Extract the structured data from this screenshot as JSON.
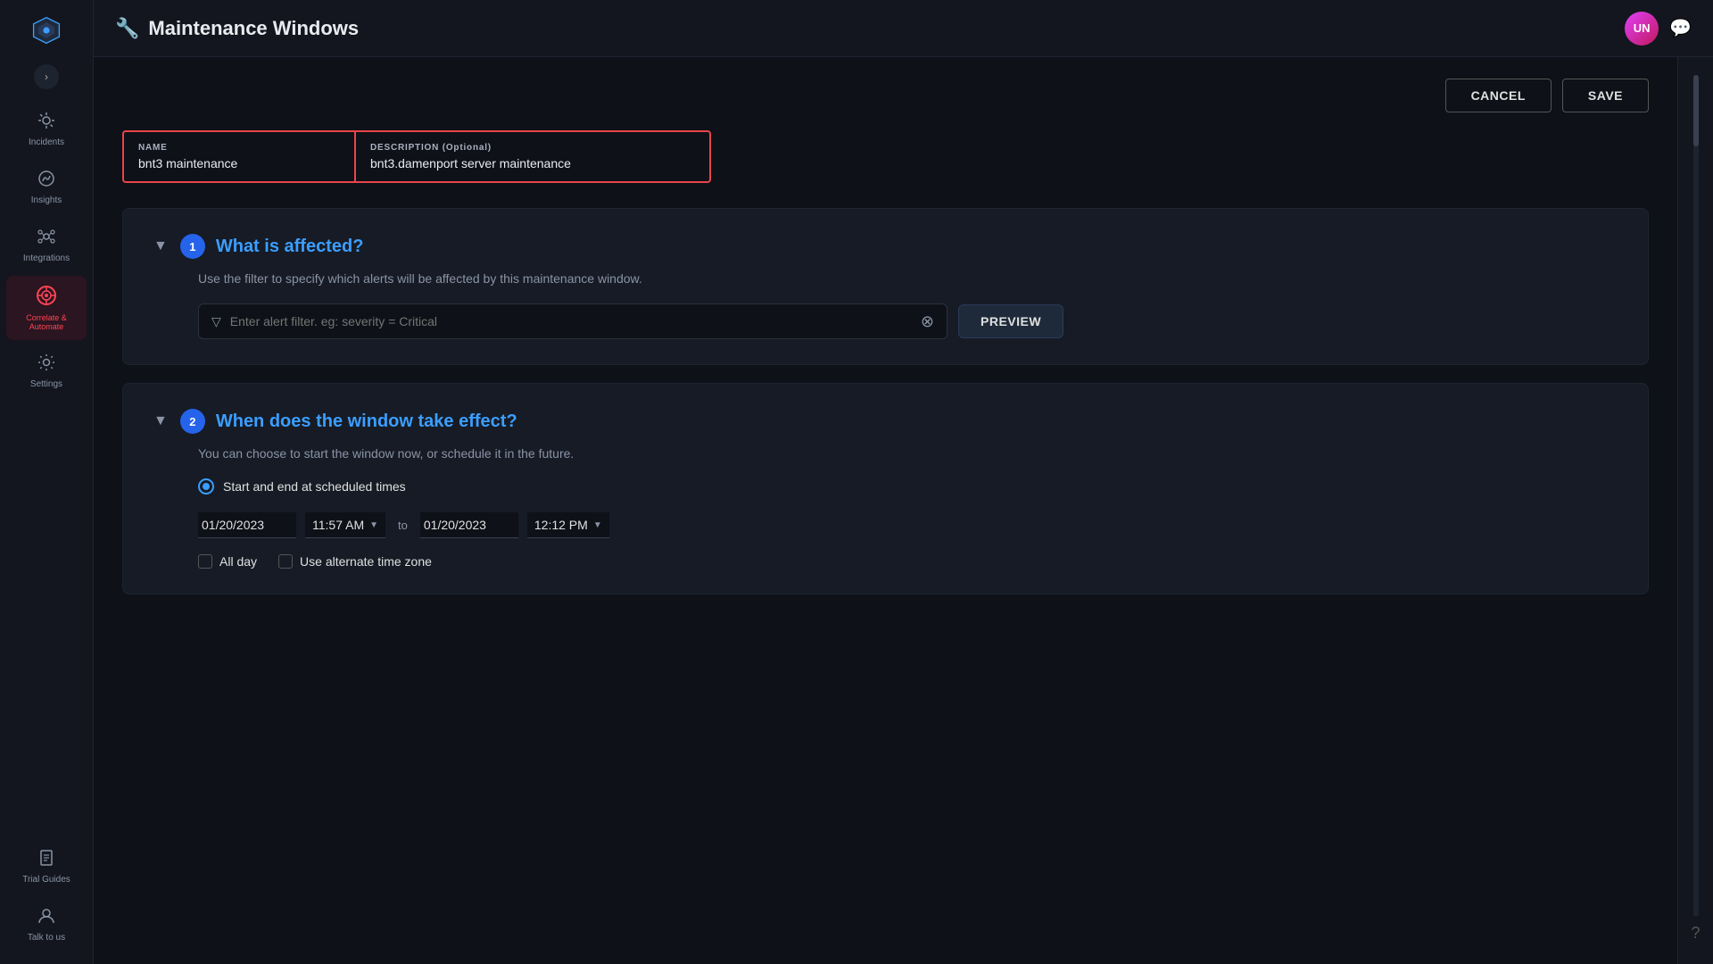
{
  "app": {
    "title": "Maintenance Windows",
    "header_icon": "🔧",
    "avatar_initials": "UN"
  },
  "sidebar": {
    "nav_items": [
      {
        "id": "incidents",
        "icon": "✦",
        "label": "Incidents"
      },
      {
        "id": "insights",
        "icon": "◕",
        "label": "Insights"
      },
      {
        "id": "integrations",
        "icon": "⊕",
        "label": "Integrations"
      },
      {
        "id": "correlate",
        "icon": "◎",
        "label": "Correlate & Automate",
        "active": true
      },
      {
        "id": "settings",
        "icon": "⚙",
        "label": "Settings"
      }
    ],
    "bottom_items": [
      {
        "id": "trial-guides",
        "icon": "👤",
        "label": "Trial Guides"
      },
      {
        "id": "talk",
        "icon": "👤",
        "label": "Talk to us"
      }
    ]
  },
  "actions": {
    "cancel_label": "CANCEL",
    "save_label": "SAVE"
  },
  "form": {
    "name_label": "NAME",
    "name_value": "bnt3 maintenance",
    "desc_label": "DESCRIPTION (Optional)",
    "desc_value": "bnt3.damenport server maintenance"
  },
  "section1": {
    "step": "1",
    "title": "What is affected?",
    "description": "Use the filter to specify which alerts will be affected by this maintenance window.",
    "filter_placeholder": "Enter alert filter. eg: severity = Critical",
    "preview_label": "PREVIEW"
  },
  "section2": {
    "step": "2",
    "title": "When does the window take effect?",
    "description": "You can choose to start the window now, or schedule it in the future.",
    "radio_label": "Start and end at scheduled times",
    "start_date": "01/20/2023",
    "start_time": "11:57 AM",
    "to_label": "to",
    "end_date": "01/20/2023",
    "end_time": "12:12 PM",
    "allday_label": "All day",
    "alternate_tz_label": "Use alternate time zone"
  }
}
